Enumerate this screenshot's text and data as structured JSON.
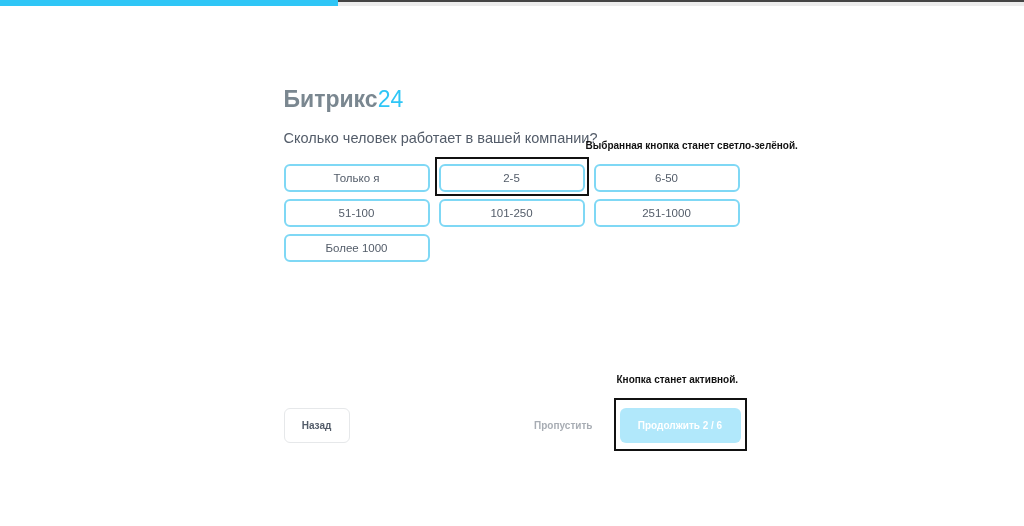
{
  "progress": {
    "level": 0.33
  },
  "logo": {
    "name": "Битрикс",
    "suffix": "24"
  },
  "question": "Сколько человек работает в вашей компании?",
  "options": [
    {
      "label": "Только я",
      "selected": false,
      "highlighted": false
    },
    {
      "label": "2-5",
      "selected": false,
      "highlighted": true
    },
    {
      "label": "6-50",
      "selected": false,
      "highlighted": false
    },
    {
      "label": "51-100",
      "selected": false,
      "highlighted": false
    },
    {
      "label": "101-250",
      "selected": false,
      "highlighted": false
    },
    {
      "label": "251-1000",
      "selected": false,
      "highlighted": false
    },
    {
      "label": "Более 1000",
      "selected": false,
      "highlighted": false
    }
  ],
  "options_note": "Выбранная кнопка станет светло-зелёной.",
  "back_button": "Назад",
  "skip_link": "Пропустить",
  "continue_button": {
    "label": "Продолжить 2 / 6",
    "disabled": true,
    "highlighted": true,
    "note": "Кнопка станет активной."
  }
}
